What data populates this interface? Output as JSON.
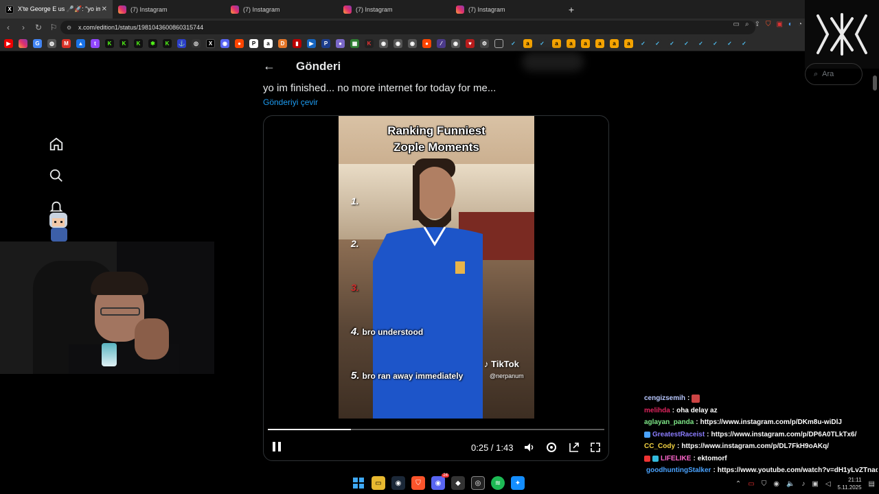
{
  "browser": {
    "tabs": [
      {
        "icon": "x-icon",
        "label": "X'te George E us 🎤🚀: \"yo im"
      },
      {
        "icon": "instagram-icon",
        "label": "(7) Instagram"
      },
      {
        "icon": "instagram-icon",
        "label": "(7) Instagram"
      },
      {
        "icon": "instagram-icon",
        "label": "(7) Instagram"
      },
      {
        "icon": "instagram-icon",
        "label": "(7) Instagram"
      }
    ],
    "new_tab": "+",
    "url": "x.com/edition1/status/1981043600860315744"
  },
  "x": {
    "header_title": "Gönderi",
    "post_text": "yo im finished... no more internet for today for me...",
    "translate_label": "Gönderiyi çevir",
    "search_placeholder": "Ara"
  },
  "video": {
    "headline_line1": "Ranking Funniest",
    "headline_line2": "Zople Moments",
    "numbers": [
      "1.",
      "2.",
      "3."
    ],
    "caption4_num": "4.",
    "caption4_text": "bro understood",
    "caption5_num": "5.",
    "caption5_text": "bro ran away immediately",
    "watermark": "TikTok",
    "handle": "@nerpanum",
    "time": "0:25 / 1:43",
    "progress": 0.247
  },
  "chat": [
    {
      "user": "cengizsemih",
      "color": "#b9c8ff",
      "msg": ""
    },
    {
      "user": "melihda",
      "color": "#e0245e",
      "msg": "oha delay az"
    },
    {
      "user": "aglayan_panda",
      "color": "#7ee787",
      "msg": "https://www.instagram.com/p/DKm8u-wiDlJ"
    },
    {
      "user": "GreatestRaceist",
      "color": "#8b7dff",
      "msg": "https://www.instagram.com/p/DP6A0TLkTx6/"
    },
    {
      "user": "CC_Cody",
      "color": "#f5d442",
      "msg": "https://www.instagram.com/p/DL7FkH9oAKq/"
    },
    {
      "user": "LIFELIKE",
      "color": "#ff66cc",
      "msg": "ektomorf"
    },
    {
      "user": "goodhuntingStalker",
      "color": "#4aa3ff",
      "msg": "https://www.youtube.com/watch?v=dH1yLvZTnac"
    }
  ],
  "taskbar": {
    "time": "21:11",
    "date": "5.11.2025",
    "discord_badge": "24"
  },
  "colors": {
    "accent": "#1d9bf0",
    "background": "#000000"
  }
}
